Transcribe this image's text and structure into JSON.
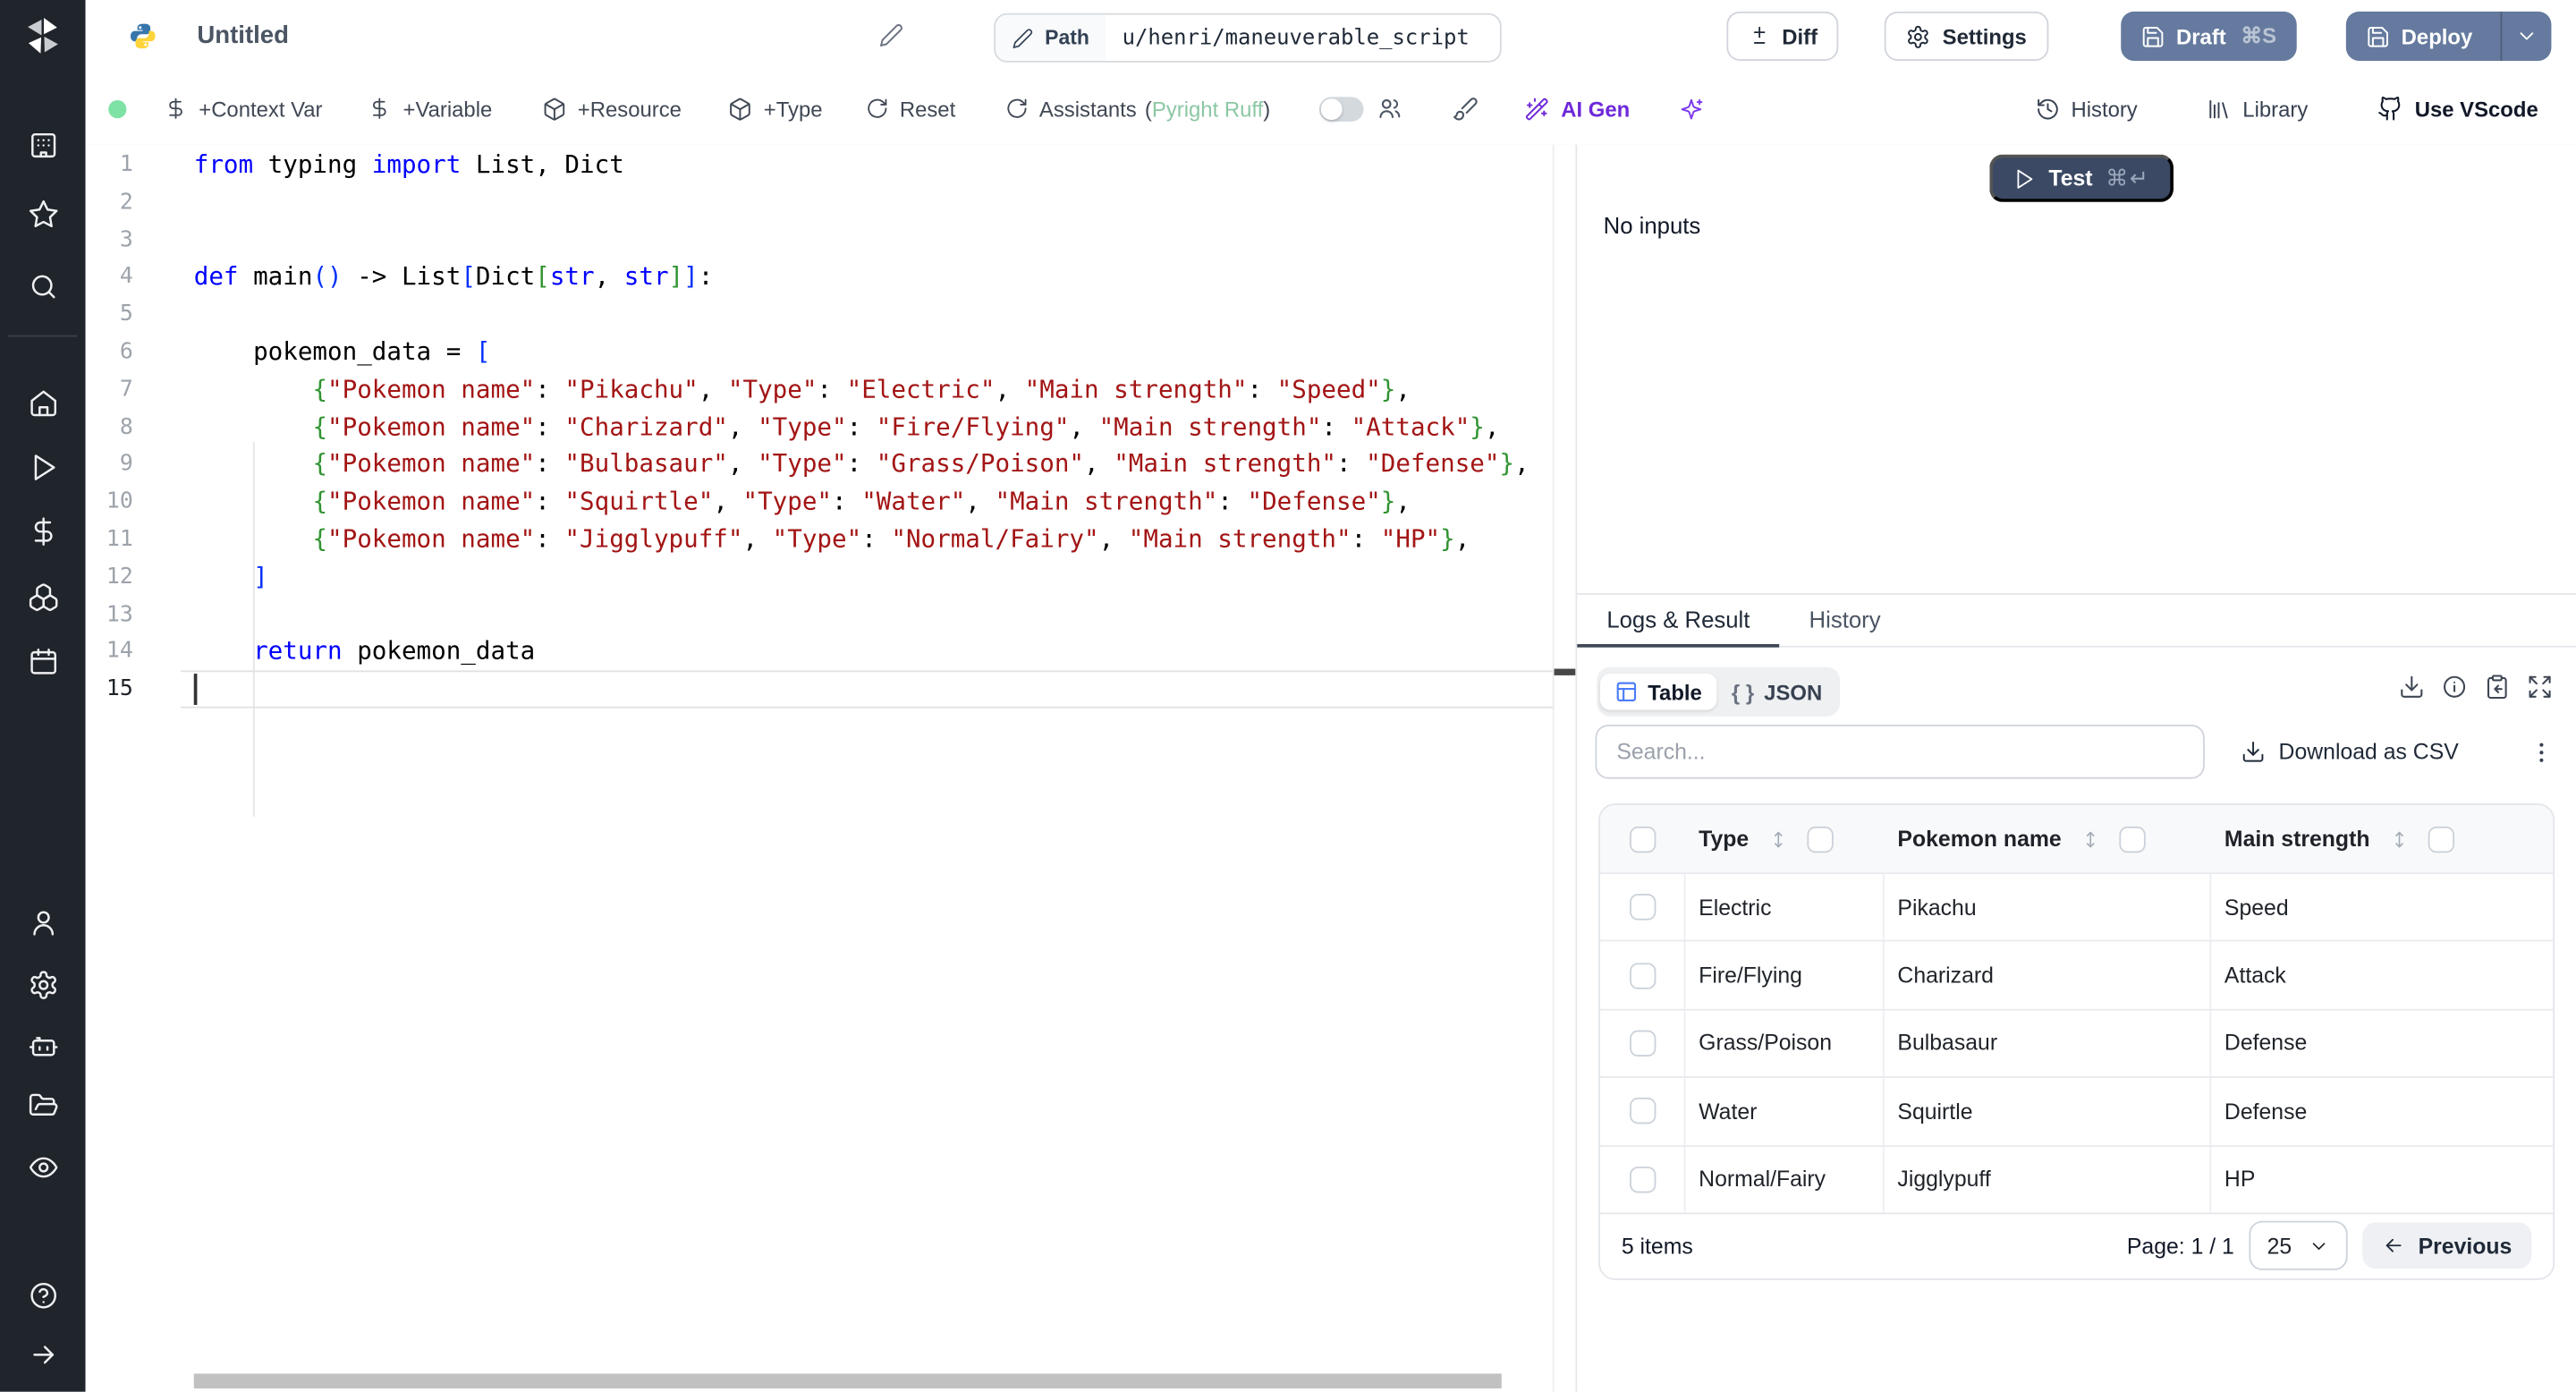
{
  "app": {
    "title": "Untitled",
    "language": "python"
  },
  "header": {
    "path": {
      "label": "Path",
      "value": "u/henri/maneuverable_script"
    },
    "diff": "Diff",
    "settings": "Settings",
    "draft": "Draft",
    "draft_kbd": "⌘S",
    "deploy": "Deploy"
  },
  "toolbar": {
    "add_context_var": "+Context Var",
    "add_variable": "+Variable",
    "add_resource": "+Resource",
    "add_type": "+Type",
    "reset": "Reset",
    "assistants": "Assistants",
    "paren_open": "(",
    "assistants_detail": "Pyright Ruff",
    "paren_close": ")",
    "ai_gen": "AI Gen",
    "history": "History",
    "library": "Library",
    "use_vscode": "Use VScode"
  },
  "editor": {
    "active_line": 15,
    "lines": [
      {
        "n": 1,
        "segs": [
          [
            "k",
            "from"
          ],
          [
            "p",
            " typing "
          ],
          [
            "k",
            "import"
          ],
          [
            "p",
            " List, Dict"
          ]
        ]
      },
      {
        "n": 2,
        "segs": []
      },
      {
        "n": 3,
        "segs": []
      },
      {
        "n": 4,
        "segs": [
          [
            "k",
            "def"
          ],
          [
            "p",
            " main"
          ],
          [
            "b1",
            "()"
          ],
          [
            "p",
            " -> List"
          ],
          [
            "b1",
            "["
          ],
          [
            "p",
            "Dict"
          ],
          [
            "b2",
            "["
          ],
          [
            "k",
            "str"
          ],
          [
            "p",
            ", "
          ],
          [
            "k",
            "str"
          ],
          [
            "b2",
            "]"
          ],
          [
            "b1",
            "]"
          ],
          [
            "p",
            ":"
          ]
        ]
      },
      {
        "n": 5,
        "segs": []
      },
      {
        "n": 6,
        "segs": [
          [
            "p",
            "    pokemon_data = "
          ],
          [
            "b1",
            "["
          ]
        ]
      },
      {
        "n": 7,
        "segs": [
          [
            "p",
            "        "
          ],
          [
            "b2",
            "{"
          ],
          [
            "s",
            "\"Pokemon name\""
          ],
          [
            "p",
            ": "
          ],
          [
            "s",
            "\"Pikachu\""
          ],
          [
            "p",
            ", "
          ],
          [
            "s",
            "\"Type\""
          ],
          [
            "p",
            ": "
          ],
          [
            "s",
            "\"Electric\""
          ],
          [
            "p",
            ", "
          ],
          [
            "s",
            "\"Main strength\""
          ],
          [
            "p",
            ": "
          ],
          [
            "s",
            "\"Speed\""
          ],
          [
            "b2",
            "}"
          ],
          [
            "p",
            ","
          ]
        ]
      },
      {
        "n": 8,
        "segs": [
          [
            "p",
            "        "
          ],
          [
            "b2",
            "{"
          ],
          [
            "s",
            "\"Pokemon name\""
          ],
          [
            "p",
            ": "
          ],
          [
            "s",
            "\"Charizard\""
          ],
          [
            "p",
            ", "
          ],
          [
            "s",
            "\"Type\""
          ],
          [
            "p",
            ": "
          ],
          [
            "s",
            "\"Fire/Flying\""
          ],
          [
            "p",
            ", "
          ],
          [
            "s",
            "\"Main strength\""
          ],
          [
            "p",
            ": "
          ],
          [
            "s",
            "\"Attack\""
          ],
          [
            "b2",
            "}"
          ],
          [
            "p",
            ","
          ]
        ]
      },
      {
        "n": 9,
        "segs": [
          [
            "p",
            "        "
          ],
          [
            "b2",
            "{"
          ],
          [
            "s",
            "\"Pokemon name\""
          ],
          [
            "p",
            ": "
          ],
          [
            "s",
            "\"Bulbasaur\""
          ],
          [
            "p",
            ", "
          ],
          [
            "s",
            "\"Type\""
          ],
          [
            "p",
            ": "
          ],
          [
            "s",
            "\"Grass/Poison\""
          ],
          [
            "p",
            ", "
          ],
          [
            "s",
            "\"Main strength\""
          ],
          [
            "p",
            ": "
          ],
          [
            "s",
            "\"Defense\""
          ],
          [
            "b2",
            "}"
          ],
          [
            "p",
            ","
          ]
        ]
      },
      {
        "n": 10,
        "segs": [
          [
            "p",
            "        "
          ],
          [
            "b2",
            "{"
          ],
          [
            "s",
            "\"Pokemon name\""
          ],
          [
            "p",
            ": "
          ],
          [
            "s",
            "\"Squirtle\""
          ],
          [
            "p",
            ", "
          ],
          [
            "s",
            "\"Type\""
          ],
          [
            "p",
            ": "
          ],
          [
            "s",
            "\"Water\""
          ],
          [
            "p",
            ", "
          ],
          [
            "s",
            "\"Main strength\""
          ],
          [
            "p",
            ": "
          ],
          [
            "s",
            "\"Defense\""
          ],
          [
            "b2",
            "}"
          ],
          [
            "p",
            ","
          ]
        ]
      },
      {
        "n": 11,
        "segs": [
          [
            "p",
            "        "
          ],
          [
            "b2",
            "{"
          ],
          [
            "s",
            "\"Pokemon name\""
          ],
          [
            "p",
            ": "
          ],
          [
            "s",
            "\"Jigglypuff\""
          ],
          [
            "p",
            ", "
          ],
          [
            "s",
            "\"Type\""
          ],
          [
            "p",
            ": "
          ],
          [
            "s",
            "\"Normal/Fairy\""
          ],
          [
            "p",
            ", "
          ],
          [
            "s",
            "\"Main strength\""
          ],
          [
            "p",
            ": "
          ],
          [
            "s",
            "\"HP\""
          ],
          [
            "b2",
            "}"
          ],
          [
            "p",
            ","
          ]
        ]
      },
      {
        "n": 12,
        "segs": [
          [
            "p",
            "    "
          ],
          [
            "b1",
            "]"
          ]
        ]
      },
      {
        "n": 13,
        "segs": []
      },
      {
        "n": 14,
        "segs": [
          [
            "p",
            "    "
          ],
          [
            "k",
            "return"
          ],
          [
            "p",
            " pokemon_data"
          ]
        ]
      },
      {
        "n": 15,
        "segs": []
      }
    ]
  },
  "run_panel": {
    "test": "Test",
    "test_kbd": "⌘↵",
    "no_inputs": "No inputs"
  },
  "results": {
    "tabs": [
      "Logs & Result",
      "History"
    ],
    "active_tab": "Logs & Result",
    "view_toggle": {
      "table": "Table",
      "json_braces": "{ }",
      "json": "JSON"
    },
    "search_placeholder": "Search...",
    "download_csv": "Download as CSV",
    "table": {
      "columns": [
        "Type",
        "Pokemon name",
        "Main strength"
      ],
      "rows": [
        [
          "Electric",
          "Pikachu",
          "Speed"
        ],
        [
          "Fire/Flying",
          "Charizard",
          "Attack"
        ],
        [
          "Grass/Poison",
          "Bulbasaur",
          "Defense"
        ],
        [
          "Water",
          "Squirtle",
          "Defense"
        ],
        [
          "Normal/Fairy",
          "Jigglypuff",
          "HP"
        ]
      ],
      "footer": {
        "items": "5 items",
        "page": "Page: 1 / 1",
        "page_size": "25",
        "previous": "Previous"
      }
    }
  },
  "sidebar_icons": [
    "windmill-logo",
    "workspace",
    "favorites",
    "search",
    "home",
    "runs",
    "variables",
    "resources",
    "schedules",
    "users",
    "settings",
    "workers",
    "folders",
    "audit-logs",
    "help",
    "expand-sidebar"
  ],
  "colors": {
    "sidebar_bg": "#20242b",
    "primary_button": "#657a9e",
    "test_button": "#3b4964",
    "status_green": "#7de2a4",
    "assistant_green": "#8bc7a3",
    "ai_purple": "#6d28d9",
    "table_icon_blue": "#4b7df8",
    "keyword": "#0000ff",
    "string": "#a31515",
    "bracket1": "#0431fa",
    "bracket2": "#319331"
  }
}
